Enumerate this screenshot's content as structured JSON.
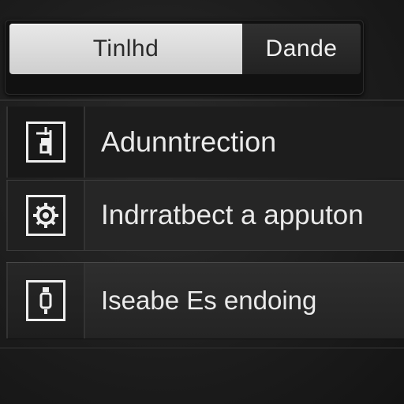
{
  "segmented_control": {
    "options": [
      {
        "label": "Tinlhd",
        "selected": true
      },
      {
        "label": "Dande",
        "selected": false
      }
    ]
  },
  "list": {
    "items": [
      {
        "label": "Adunntrection",
        "icon": "bottle-icon"
      },
      {
        "label": "Indrratbect a apputon",
        "icon": "gear-icon"
      },
      {
        "label": "Iseabe Es  endoing",
        "icon": "badge-icon"
      }
    ]
  },
  "colors": {
    "background": "#1c1c1c",
    "selected_segment": "#dcdcdc",
    "text": "#eaeaea"
  }
}
